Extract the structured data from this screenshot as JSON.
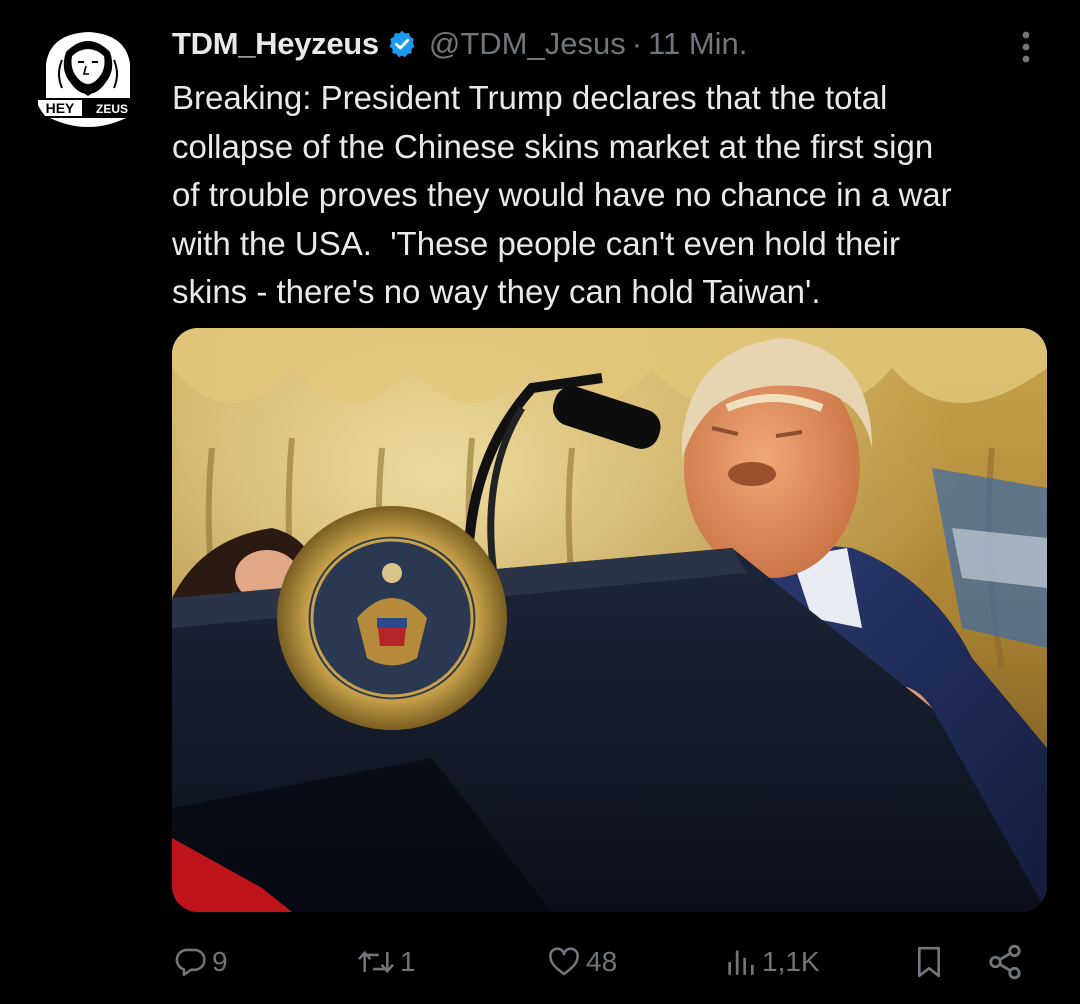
{
  "tweet": {
    "avatar": {
      "name": "heyzeus-logo",
      "text_left": "HEY",
      "text_right": "ZEUS"
    },
    "display_name": "TDM_Heyzeus",
    "handle": "@TDM_Jesus",
    "separator": "·",
    "time": "11 Min.",
    "verified_color": "#1d9bf0",
    "more_icon": "more-vertical-icon",
    "text": "Breaking: President Trump declares that the total\ncollapse of the Chinese skins market at the first sign\nof trouble proves they would have no chance in a war\nwith the USA.  'These people can't even hold their\nskins - there's no way they can hold Taiwan'.",
    "media": {
      "type": "photo"
    },
    "actions": {
      "replies": {
        "icon": "reply-icon",
        "count": "9"
      },
      "reposts": {
        "icon": "repost-icon",
        "count": "1"
      },
      "likes": {
        "icon": "heart-icon",
        "count": "48"
      },
      "views": {
        "icon": "views-icon",
        "count": "1,1K"
      },
      "bookmark": {
        "icon": "bookmark-icon"
      },
      "share": {
        "icon": "share-icon"
      }
    }
  },
  "colors": {
    "background": "#000000",
    "text": "#e7e9ea",
    "secondary": "#71767b",
    "accent": "#1d9bf0"
  }
}
